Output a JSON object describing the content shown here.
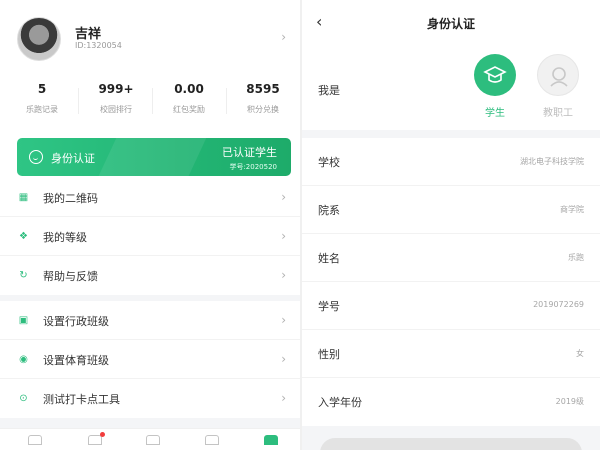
{
  "profile": {
    "name": "吉祥",
    "id_text": "ID:1320054",
    "chevron": "›"
  },
  "stats": [
    {
      "value": "5",
      "label": "乐跑记录"
    },
    {
      "value": "999+",
      "label": "校园排行"
    },
    {
      "value": "0.00",
      "label": "红包奖励"
    },
    {
      "value": "8595",
      "label": "积分兑换"
    }
  ],
  "auth_banner": {
    "title": "身份认证",
    "status": "已认证学生",
    "student_no": "学号:2020520"
  },
  "menu_group_1": [
    {
      "label": "我的二维码",
      "icon": "qrcode-icon"
    },
    {
      "label": "我的等级",
      "icon": "badge-icon"
    },
    {
      "label": "帮助与反馈",
      "icon": "headset-icon"
    }
  ],
  "menu_group_2": [
    {
      "label": "设置行政班级",
      "icon": "class-icon"
    },
    {
      "label": "设置体育班级",
      "icon": "ball-icon"
    },
    {
      "label": "测试打卡点工具",
      "icon": "location-icon"
    }
  ],
  "tabbar": {
    "icons": [
      "home-icon",
      "run-icon",
      "sport-icon",
      "message-icon",
      "mine-icon"
    ],
    "active_index": 4,
    "badge_index": 1
  },
  "auth_page": {
    "back": "‹",
    "title": "身份认证",
    "role_label": "我是",
    "roles": [
      {
        "label": "学生",
        "selected": true
      },
      {
        "label": "教职工",
        "selected": false
      }
    ],
    "fields": [
      {
        "label": "学校",
        "value": "湖北电子科技学院"
      },
      {
        "label": "院系",
        "value": "商学院"
      },
      {
        "label": "姓名",
        "value": "乐跑"
      },
      {
        "label": "学号",
        "value": "2019072269"
      },
      {
        "label": "性别",
        "value": "女"
      },
      {
        "label": "入学年份",
        "value": "2019级"
      }
    ]
  },
  "colors": {
    "accent": "#2dbd7e",
    "background_gray": "#f4f5f7",
    "badge_red": "#f23c3c"
  }
}
